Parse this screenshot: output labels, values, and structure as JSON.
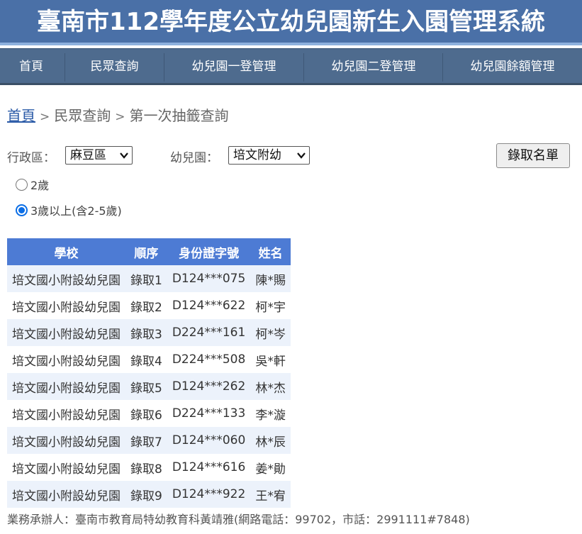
{
  "header": {
    "title": "臺南市112學年度公立幼兒園新生入園管理系統"
  },
  "nav": {
    "items": [
      {
        "label": "首頁"
      },
      {
        "label": "民眾查詢"
      },
      {
        "label": "幼兒園一登管理"
      },
      {
        "label": "幼兒園二登管理"
      },
      {
        "label": "幼兒園餘額管理"
      }
    ]
  },
  "breadcrumb": {
    "home": "首頁",
    "section": "民眾查詢",
    "current": "第一次抽籤查詢",
    "separator": ">"
  },
  "filters": {
    "district_label": "行政區：",
    "district_value": "麻豆區",
    "kindergarten_label": "幼兒園：",
    "kindergarten_value": "培文附幼",
    "submit_label": "錄取名單"
  },
  "age_options": [
    {
      "label": "2歲",
      "checked": false
    },
    {
      "label": "3歲以上(含2-5歲)",
      "checked": true
    }
  ],
  "table": {
    "headers": [
      "學校",
      "順序",
      "身份證字號",
      "姓名"
    ],
    "rows": [
      [
        "培文國小附設幼兒園",
        "錄取1",
        "D124***075",
        "陳*賜"
      ],
      [
        "培文國小附設幼兒園",
        "錄取2",
        "D124***622",
        "柯*宇"
      ],
      [
        "培文國小附設幼兒園",
        "錄取3",
        "D224***161",
        "柯*岑"
      ],
      [
        "培文國小附設幼兒園",
        "錄取4",
        "D224***508",
        "吳*軒"
      ],
      [
        "培文國小附設幼兒園",
        "錄取5",
        "D124***262",
        "林*杰"
      ],
      [
        "培文國小附設幼兒園",
        "錄取6",
        "D224***133",
        "李*漩"
      ],
      [
        "培文國小附設幼兒園",
        "錄取7",
        "D124***060",
        "林*辰"
      ],
      [
        "培文國小附設幼兒園",
        "錄取8",
        "D124***616",
        "姜*勛"
      ],
      [
        "培文國小附設幼兒園",
        "錄取9",
        "D124***922",
        "王*宥"
      ]
    ]
  },
  "footer": {
    "text": "業務承辦人：臺南市教育局特幼教育科黃靖雅(網路電話：99702，市話：2991111#7848)"
  },
  "colors": {
    "header_bg": "#4a70a7",
    "nav_bg": "#4e6b8e",
    "table_header_bg": "#4d7bd4",
    "row_stripe": "#ecf2fb",
    "radio_checked": "#0b6ee6"
  }
}
